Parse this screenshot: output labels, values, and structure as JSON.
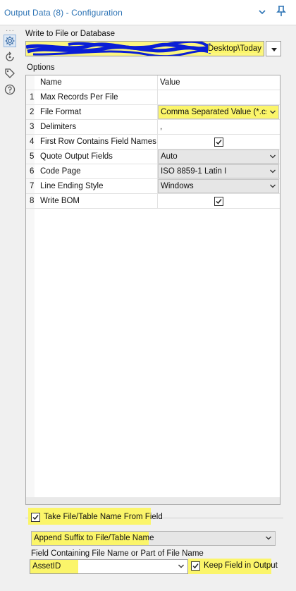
{
  "header": {
    "title": "Output Data (8) - Configuration",
    "collapse_icon": "chevron-down-icon",
    "pin_icon": "pin-icon"
  },
  "sidebar": {
    "more_label": "···",
    "icons": [
      "gear-icon",
      "rotate-icon",
      "tag-icon",
      "help-icon"
    ]
  },
  "write_to": {
    "label": "Write to File or Database",
    "path_visible": "Desktop\\Today",
    "path_redacted": true
  },
  "options": {
    "section_label": "Options",
    "columns": [
      "Name",
      "Value"
    ],
    "rows": [
      {
        "num": "1",
        "name": "Max Records Per File",
        "value": ""
      },
      {
        "num": "2",
        "name": "File Format",
        "value": "Comma Separated Value (*.csv)"
      },
      {
        "num": "3",
        "name": "Delimiters",
        "value": ","
      },
      {
        "num": "4",
        "name": "First Row Contains Field Names",
        "checked": true
      },
      {
        "num": "5",
        "name": "Quote Output Fields",
        "value": "Auto"
      },
      {
        "num": "6",
        "name": "Code Page",
        "value": "ISO 8859-1 Latin I"
      },
      {
        "num": "7",
        "name": "Line Ending Style",
        "value": "Windows"
      },
      {
        "num": "8",
        "name": "Write BOM",
        "checked": true
      }
    ]
  },
  "bottom": {
    "take_name_label": "Take File/Table Name From Field",
    "take_name_checked": true,
    "append_mode": "Append Suffix to File/Table Name",
    "field_label": "Field Containing File Name or Part of File Name",
    "field_value": "AssetID",
    "keep_field_label": "Keep Field in Output",
    "keep_field_checked": true
  },
  "colors": {
    "title_blue": "#2e74b5",
    "highlight_yellow": "#fbf56a",
    "scribble_blue": "#0a1ed6"
  }
}
